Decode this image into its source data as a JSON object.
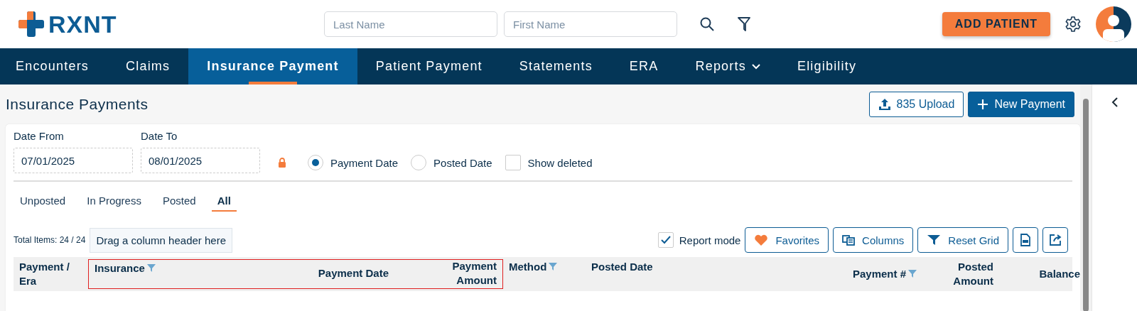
{
  "header": {
    "logo": "RXNT",
    "last_name": {
      "placeholder": "Last Name"
    },
    "first_name": {
      "placeholder": "First Name"
    },
    "add_patient": "ADD PATIENT"
  },
  "nav": [
    {
      "label": "Encounters",
      "selected": false,
      "dropdown": false
    },
    {
      "label": "Claims",
      "selected": false,
      "dropdown": false
    },
    {
      "label": "Insurance Payment",
      "selected": true,
      "dropdown": false
    },
    {
      "label": "Patient Payment",
      "selected": false,
      "dropdown": false
    },
    {
      "label": "Statements",
      "selected": false,
      "dropdown": false
    },
    {
      "label": "ERA",
      "selected": false,
      "dropdown": false
    },
    {
      "label": "Reports",
      "selected": false,
      "dropdown": true
    },
    {
      "label": "Eligibility",
      "selected": false,
      "dropdown": false
    }
  ],
  "page_title": "Insurance Payments",
  "actions": [
    {
      "label": "835 Upload",
      "kind": "upload"
    },
    {
      "label": "New Payment",
      "kind": "new"
    }
  ],
  "filters": {
    "date_from": {
      "label": "Date From",
      "value": "07/01/2025"
    },
    "date_to": {
      "label": "Date To",
      "value": "08/01/2025"
    },
    "radios": [
      {
        "label": "Payment Date",
        "selected": true
      },
      {
        "label": "Posted Date",
        "selected": false
      }
    ],
    "show_deleted": {
      "label": "Show deleted",
      "checked": false
    }
  },
  "status_tabs": [
    {
      "label": "Unposted",
      "selected": false
    },
    {
      "label": "In Progress",
      "selected": false
    },
    {
      "label": "Posted",
      "selected": false
    },
    {
      "label": "All",
      "selected": true
    }
  ],
  "grid_toolbar": {
    "total_items": "Total Items: 24 / 24",
    "group_hint": "Drag a column header here",
    "report_mode": {
      "label": "Report mode",
      "checked": true
    },
    "buttons": [
      {
        "label": "Favorites",
        "kind": "favorites"
      },
      {
        "label": "Columns",
        "kind": "columns"
      },
      {
        "label": "Reset Grid",
        "kind": "reset"
      },
      {
        "kind": "pdf"
      },
      {
        "kind": "export"
      }
    ]
  },
  "table": {
    "columns": [
      {
        "label": "Payment / Era",
        "filter": false,
        "highlighted": false
      },
      {
        "label": "Insurance",
        "filter": true,
        "highlighted": true
      },
      {
        "label": "Payment Date",
        "filter": false,
        "highlighted": true
      },
      {
        "label": "Payment Amount",
        "filter": false,
        "highlighted": true
      },
      {
        "label": "Method",
        "filter": true,
        "highlighted": false
      },
      {
        "label": "Posted Date",
        "filter": false,
        "highlighted": false
      },
      {
        "label": "Payment #",
        "filter": true,
        "highlighted": false
      },
      {
        "label": "Posted Amount",
        "filter": false,
        "highlighted": false
      },
      {
        "label": "Balance",
        "filter": false,
        "highlighted": false
      }
    ]
  }
}
